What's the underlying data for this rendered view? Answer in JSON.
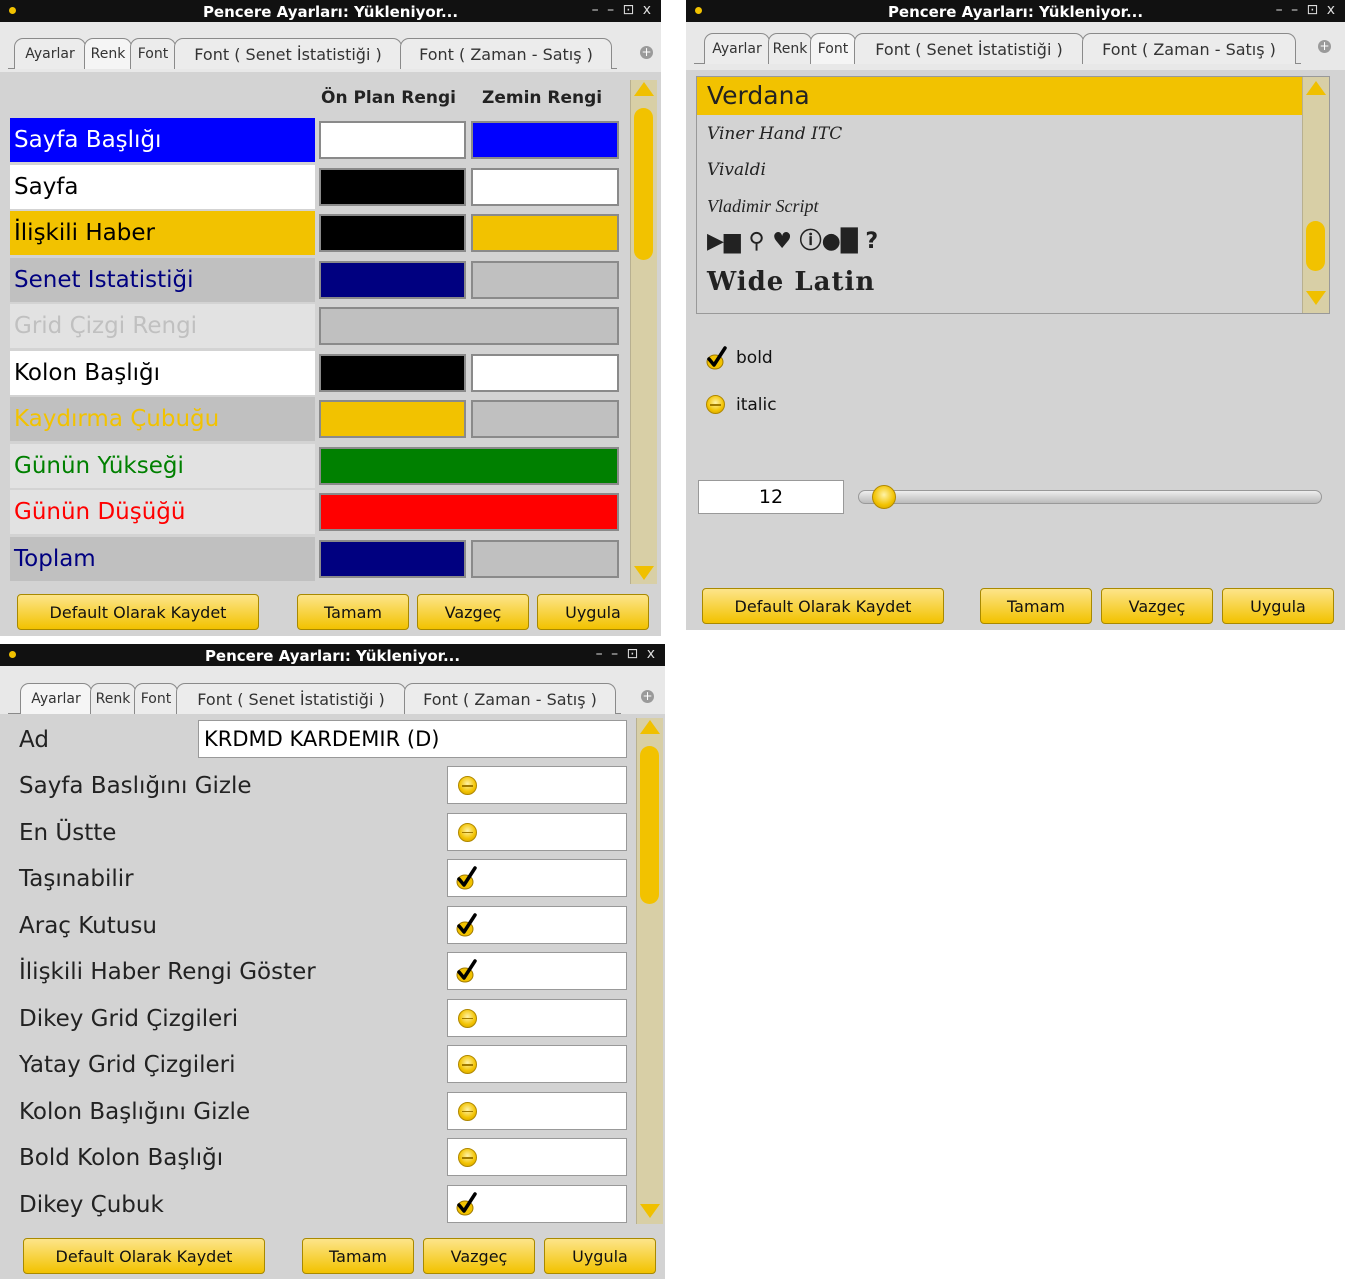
{
  "common": {
    "title": "Pencere Ayarları: Yükleniyor...",
    "window_controls": "– – ⊡ x",
    "tabs": [
      "Ayarlar",
      "Renk",
      "Font",
      "Font ( Senet İstatistiği )",
      "Font ( Zaman - Satış )"
    ],
    "plus_icon": "+",
    "buttons": {
      "default": "Default Olarak Kaydet",
      "ok": "Tamam",
      "cancel": "Vazgeç",
      "apply": "Uygula"
    },
    "accent": "#f2c200"
  },
  "renk": {
    "header_fg": "Ön Plan Rengi",
    "header_bg": "Zemin Rengi",
    "rows": [
      {
        "label": "Sayfa Başlığı",
        "text_color": "#ffffff",
        "row_bg": "#0000ff",
        "fg": "#ffffff",
        "bg": "#0000ff"
      },
      {
        "label": "Sayfa",
        "text_color": "#000000",
        "row_bg": "#ffffff",
        "fg": "#000000",
        "bg": "#ffffff"
      },
      {
        "label": "İlişkili Haber",
        "text_color": "#000000",
        "row_bg": "#f2c200",
        "fg": "#000000",
        "bg": "#f2c200"
      },
      {
        "label": "Senet Istatistiği",
        "text_color": "#000080",
        "row_bg": "#c0c0c0",
        "fg": "#000080",
        "bg": "#c0c0c0"
      },
      {
        "label": "Grid Çizgi Rengi",
        "text_color": "#c0c0c0",
        "row_bg": "#e2e2e2",
        "fg": "#c0c0c0",
        "bg": null
      },
      {
        "label": "Kolon Başlığı",
        "text_color": "#000000",
        "row_bg": "#ffffff",
        "fg": "#000000",
        "bg": "#ffffff"
      },
      {
        "label": "Kaydırma Çubuğu",
        "text_color": "#f2c200",
        "row_bg": "#c0c0c0",
        "fg": "#f2c200",
        "bg": "#c0c0c0"
      },
      {
        "label": "Günün Yükseği",
        "text_color": "#008000",
        "row_bg": "#e2e2e2",
        "fg": "#008000",
        "bg": null
      },
      {
        "label": "Günün Düşüğü",
        "text_color": "#ff0000",
        "row_bg": "#e2e2e2",
        "fg": "#ff0000",
        "bg": null
      },
      {
        "label": "Toplam",
        "text_color": "#000080",
        "row_bg": "#c0c0c0",
        "fg": "#000080",
        "bg": "#c0c0c0"
      }
    ]
  },
  "font": {
    "fonts": [
      "Verdana",
      "Viner Hand ITC",
      "Vivaldi",
      "Vladimir Script",
      "▶▆ ⚲ ♥ ⓘ●█ ?",
      "Wide Latin"
    ],
    "selected": "Verdana",
    "bold_label": "bold",
    "bold_checked": true,
    "italic_label": "italic",
    "italic_checked": false,
    "size": "12",
    "size_slider_fraction": 0.02
  },
  "ayarlar": {
    "name_label": "Ad",
    "name_value": "KRDMD KARDEMIR (D)",
    "options": [
      {
        "label": "Sayfa Baslığını Gizle",
        "checked": false
      },
      {
        "label": "En Üstte",
        "checked": false
      },
      {
        "label": "Taşınabilir",
        "checked": true
      },
      {
        "label": "Araç Kutusu",
        "checked": true
      },
      {
        "label": "İlişkili Haber Rengi Göster",
        "checked": true
      },
      {
        "label": "Dikey Grid Çizgileri",
        "checked": false
      },
      {
        "label": "Yatay Grid Çizgileri",
        "checked": false
      },
      {
        "label": "Kolon Başlığını Gizle",
        "checked": false
      },
      {
        "label": "Bold Kolon Başlığı",
        "checked": false
      },
      {
        "label": "Dikey Çubuk",
        "checked": true
      }
    ]
  }
}
